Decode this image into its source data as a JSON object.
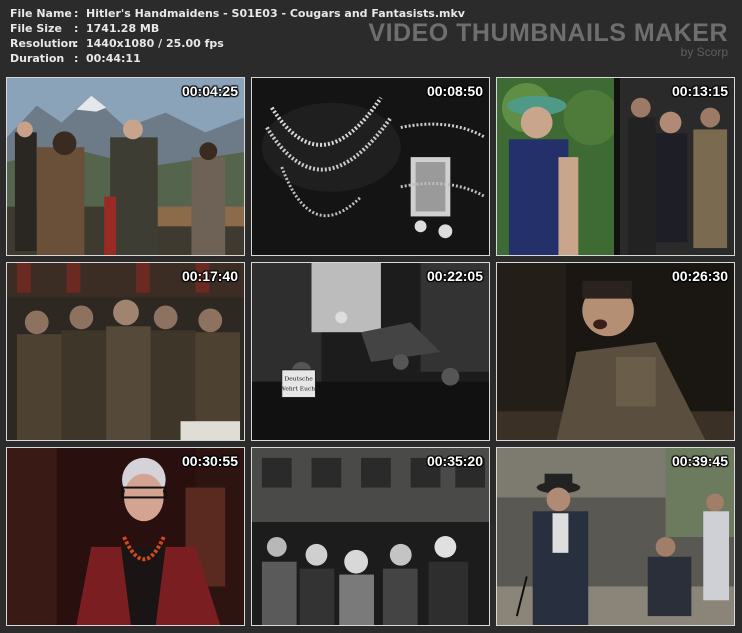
{
  "info": {
    "rows": [
      {
        "label": "File Name",
        "value": "Hitler's Handmaidens - S01E03 - Cougars and Fantasists.mkv"
      },
      {
        "label": "File Size",
        "value": "1741.28 MB"
      },
      {
        "label": "Resolution",
        "value": "1440x1080 / 25.00 fps"
      },
      {
        "label": "Duration",
        "value": "00:44:11"
      }
    ],
    "separator": ":"
  },
  "brand": {
    "title": "VIDEO THUMBNAILS MAKER",
    "byline": "by Scorp"
  },
  "thumbnails": [
    {
      "timestamp": "00:04:25",
      "scene": "mountain-terrace-scene"
    },
    {
      "timestamp": "00:08:50",
      "scene": "jewelry-scene"
    },
    {
      "timestamp": "00:13:15",
      "scene": "garden-crowd-scene"
    },
    {
      "timestamp": "00:17:40",
      "scene": "uniformed-crowd-scene"
    },
    {
      "timestamp": "00:22:05",
      "scene": "street-sign-scene"
    },
    {
      "timestamp": "00:26:30",
      "scene": "speech-scene"
    },
    {
      "timestamp": "00:30:55",
      "scene": "interview-scene"
    },
    {
      "timestamp": "00:35:20",
      "scene": "street-crowd-scene"
    },
    {
      "timestamp": "00:39:45",
      "scene": "street-gentleman-scene"
    }
  ],
  "scene_texts": {
    "sign_line1": "Deutsche",
    "sign_line2": "Wehrt Euch!"
  },
  "colors": {
    "background": "#2b2b2b",
    "info_text": "#e8e8e8",
    "brand_text": "#6e6e6e",
    "timestamp": "#ffffff"
  }
}
